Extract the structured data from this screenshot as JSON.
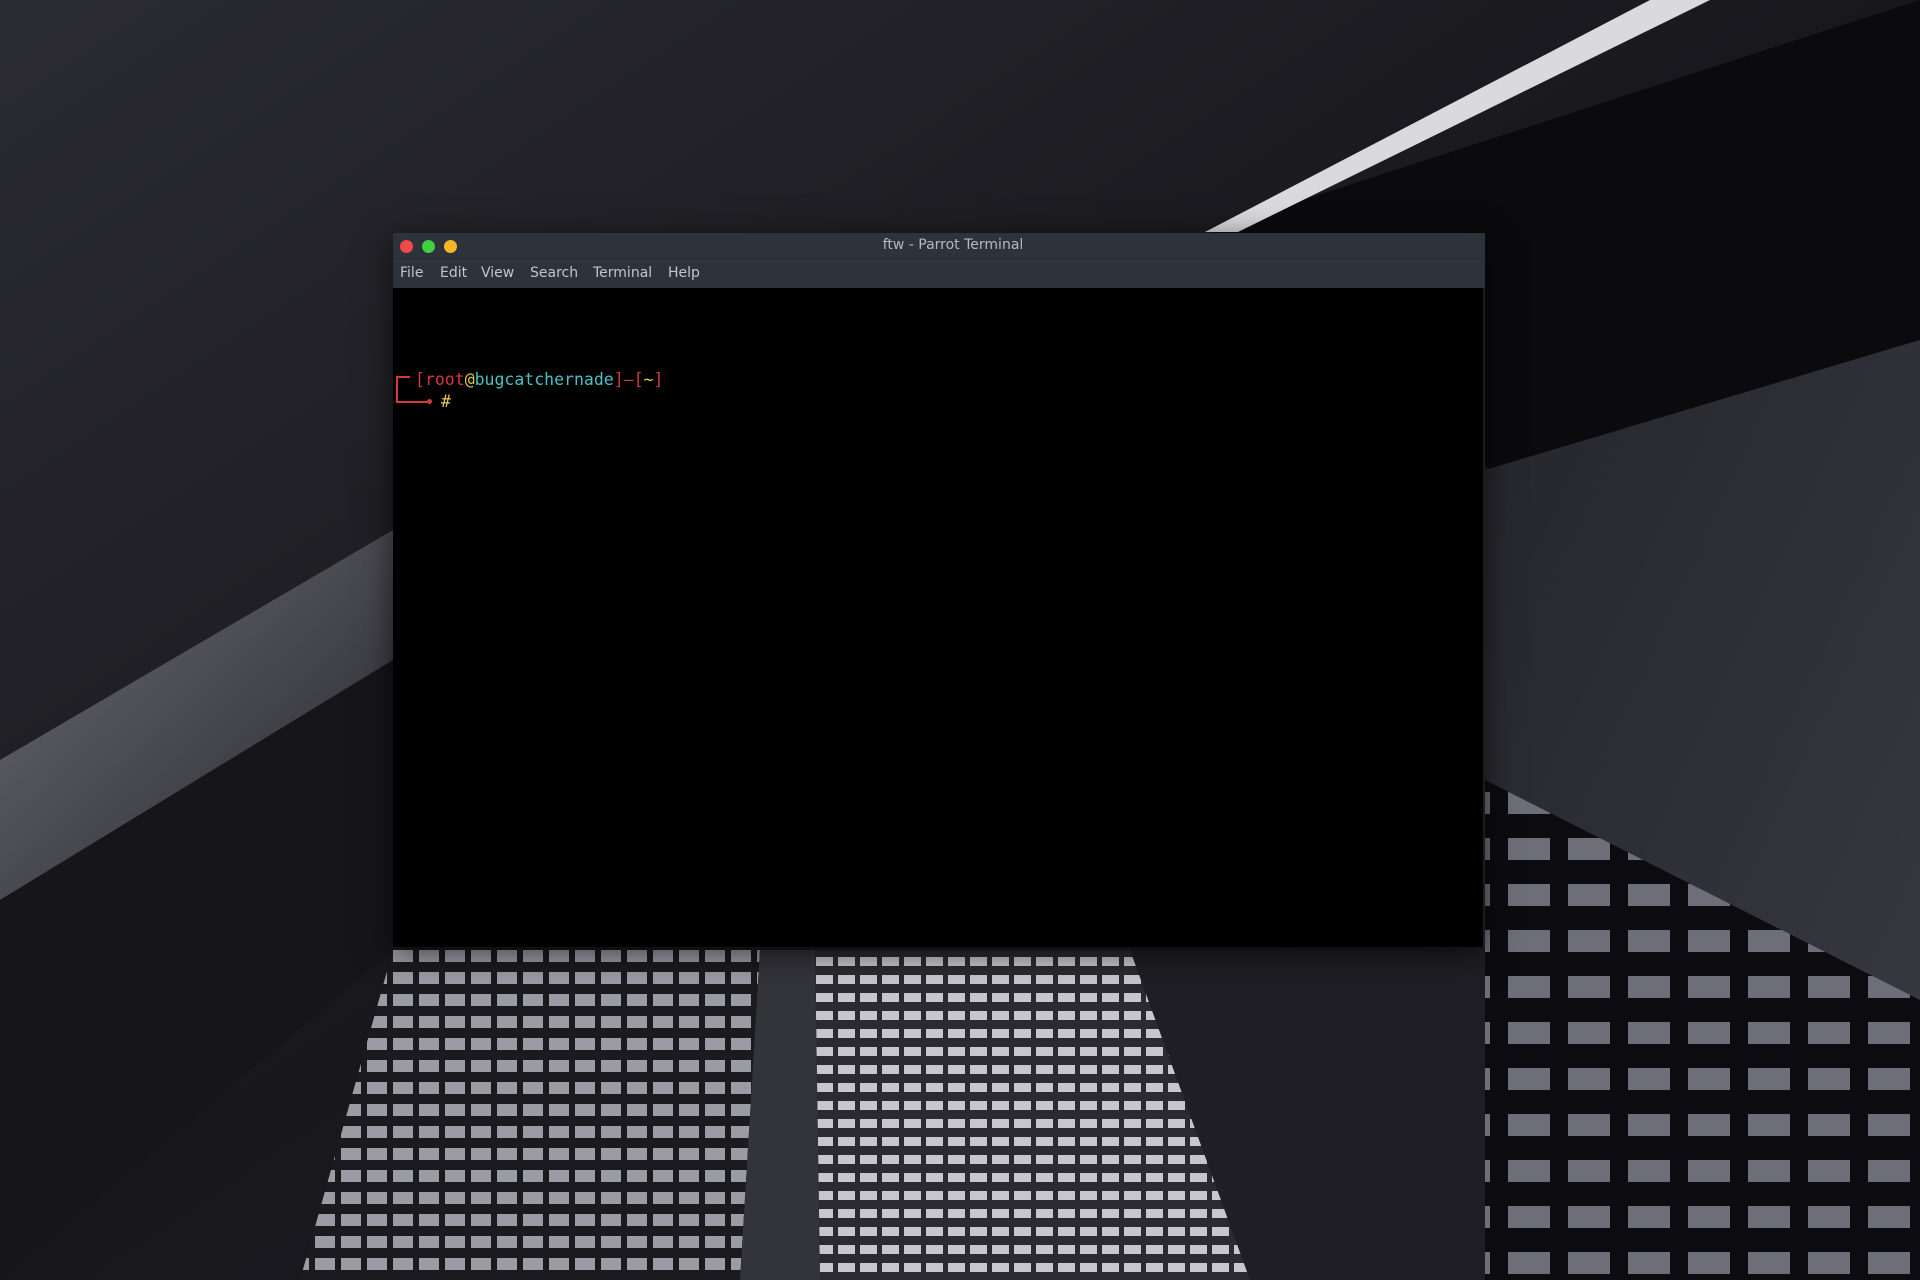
{
  "desktop": {
    "wallpaper": "dark-city-skyscrapers"
  },
  "window": {
    "title": "ftw - Parrot Terminal",
    "controls": [
      "close",
      "maximize",
      "minimize"
    ],
    "colors": {
      "close": "#ef4a4a",
      "maximize": "#3fcf3f",
      "minimize": "#f2b826",
      "titlebar": "#2d323b",
      "background": "#000000"
    }
  },
  "menu": {
    "items": [
      "File",
      "Edit",
      "View",
      "Search",
      "Terminal",
      "Help"
    ]
  },
  "terminal": {
    "prompt": {
      "open_bracket": "[",
      "user": "root",
      "at": "@",
      "host": "bugcatchernade",
      "close_bracket": "]",
      "dash": "—",
      "dir_open": "[",
      "dir": "~",
      "dir_close": "]",
      "symbol": "#"
    },
    "colors": {
      "bracket": "#d53a3a",
      "user": "#d53a3a",
      "at": "#e6c54a",
      "host": "#48c1c4",
      "symbol": "#e6c54a"
    }
  }
}
